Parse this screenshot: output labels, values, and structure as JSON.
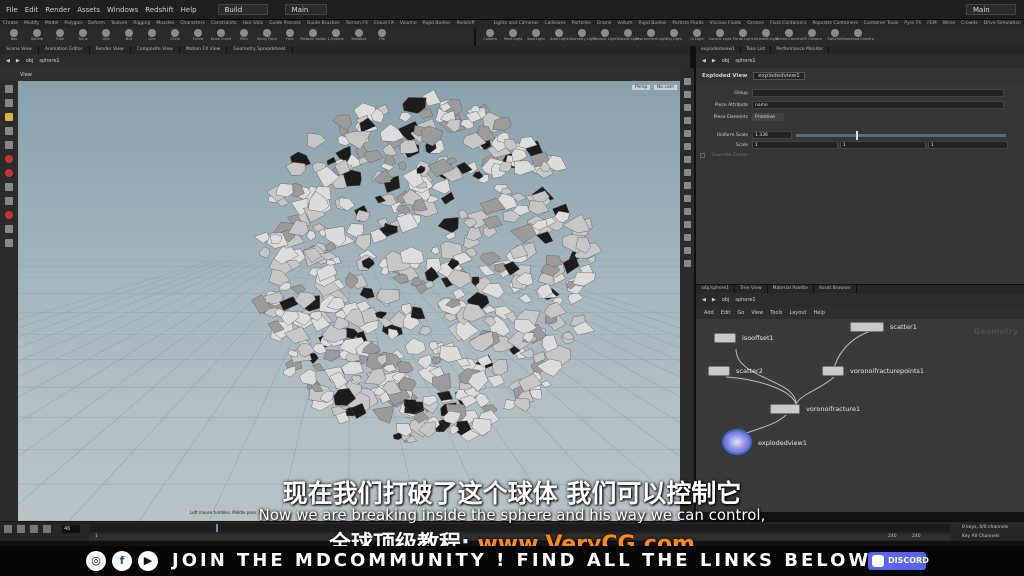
{
  "menu": [
    "File",
    "Edit",
    "Render",
    "Assets",
    "Windows",
    "Redshift",
    "Help"
  ],
  "desktop": "Build",
  "main_label": "Main",
  "desk_right": "Main",
  "shelf_tabs_left": [
    "Create",
    "Modify",
    "Model",
    "Polygon",
    "Deform",
    "Texture",
    "Rigging",
    "Muscles",
    "Characters",
    "Constraints",
    "Hair Utils",
    "Guide Process",
    "Guide Brushes",
    "Terrain FX",
    "Cloud FX",
    "Volume",
    "Rigid Bodies",
    "Redshift"
  ],
  "shelf_tabs_right": [
    "Lights and Cameras",
    "Collisions",
    "Particles",
    "Grains",
    "Vellum",
    "Rigid Bodies",
    "Particle Fluids",
    "Viscous Fluids",
    "Oceans",
    "Fluid Containers",
    "Populate Containers",
    "Container Tools",
    "Pyro FX",
    "FEM",
    "Wires",
    "Crowds",
    "Drive Simulation"
  ],
  "shelf_tools_left": [
    "Box",
    "Sphere",
    "Tube",
    "Torus",
    "Grid",
    "Null",
    "Line",
    "Circle",
    "Curve",
    "Draw Curve",
    "Path",
    "Spray Paint",
    "Font",
    "Platonic Solids",
    "L-System",
    "Metaball",
    "File"
  ],
  "shelf_tools_right": [
    "Camera",
    "Point Light",
    "Spot Light",
    "Area Light",
    "Geometry Light",
    "Volume Light",
    "Distant Light",
    "Environment Light",
    "Sky Light",
    "GI Light",
    "Caustic Light",
    "Portal Light",
    "Ambient Light",
    "Stereo Camera",
    "VR Camera",
    "Switcher",
    "Gamepad Camera"
  ],
  "pane_tabs_left": [
    "Scene View",
    "Animation Editor",
    "Render View",
    "Composite View",
    "Motion FX View",
    "Geometry Spreadsheet"
  ],
  "path_left": {
    "obj": "obj",
    "node": "sphere1"
  },
  "viewport": {
    "title": "View",
    "persp": "Persp",
    "cam": "No cam",
    "hint": "Left mouse tumbles. Middle pans. Right"
  },
  "param_tabs": [
    "explodedview1",
    "Take List",
    "Performance Monitor"
  ],
  "param_path": {
    "obj": "obj",
    "node": "sphere1"
  },
  "param_header": {
    "type": "Exploded View",
    "name": "explodedview1"
  },
  "params": {
    "group_label": "Group",
    "piece_attr_label": "Piece Attribute",
    "piece_attr_value": "name",
    "piece_elements_label": "Piece Elements",
    "piece_elements_value": "Primitive",
    "uniform_scale_label": "Uniform Scale",
    "uniform_scale_value": "1.336",
    "scale_label": "Scale",
    "scale_x": "1",
    "scale_y": "1",
    "scale_z": "1",
    "center_label": "Override Center"
  },
  "net_tabs": [
    "/obj/sphere1",
    "Tree View",
    "Material Palette",
    "Asset Browser"
  ],
  "net_path": {
    "obj": "obj",
    "node": "sphere1"
  },
  "net_menu": [
    "Add",
    "Edit",
    "Go",
    "View",
    "Tools",
    "Layout",
    "Help"
  ],
  "net_watermark": "Geometry",
  "nodes": {
    "scatter1": "scatter1",
    "isooffset1": "isooffset1",
    "scatter2": "scatter2",
    "vfp": "voronoifracturepoints1",
    "vf": "voronoifracture1",
    "ev": "explodedview1"
  },
  "timeline": {
    "frame": "46",
    "start": "1",
    "end1": "240",
    "end2": "240",
    "keys": "0 keys, 0/0 channels",
    "keys2": "Key All Channels"
  },
  "subtitles": {
    "cn": "现在我们打破了这个球体 我们可以控制它",
    "en": "Now we are breaking inside the sphere and his way we can control,",
    "site_prefix": "全球顶级教程:",
    "site": "www.VeryCG.com"
  },
  "social": {
    "icons": [
      "instagram-icon",
      "facebook-icon",
      "youtube-icon"
    ],
    "join": "JOIN THE MDCOMMUNITY ! FIND ALL THE LINKS BELOW",
    "discord": "DISCORD"
  },
  "colors": {
    "accent": "#ff8a1a",
    "discord": "#5865f2",
    "viewport_top": "#88a1ad",
    "viewport_bottom": "#b6c2c6"
  }
}
